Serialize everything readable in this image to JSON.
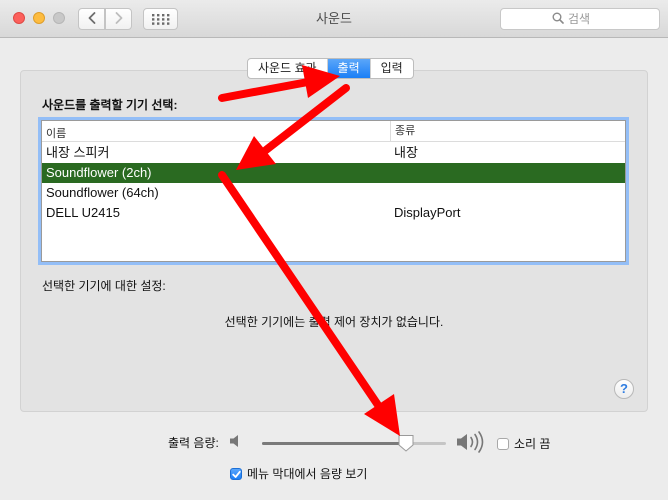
{
  "window": {
    "title": "사운드"
  },
  "toolbar": {
    "search_placeholder": "검색"
  },
  "tabs": [
    {
      "label": "사운드 효과",
      "active": false
    },
    {
      "label": "출력",
      "active": true
    },
    {
      "label": "입력",
      "active": false
    }
  ],
  "output": {
    "section_label": "사운드를 출력할 기기 선택:",
    "columns": {
      "name": "이름",
      "type": "종류"
    },
    "devices": [
      {
        "name": "내장 스피커",
        "type": "내장",
        "selected": false
      },
      {
        "name": "Soundflower (2ch)",
        "type": "",
        "selected": true
      },
      {
        "name": "Soundflower (64ch)",
        "type": "",
        "selected": false
      },
      {
        "name": "DELL U2415",
        "type": "DisplayPort",
        "selected": false
      }
    ],
    "settings_label": "선택한 기기에 대한 설정:",
    "no_controls_text": "선택한 기기에는 출력 제어 장치가 없습니다.",
    "help_label": "?"
  },
  "volume": {
    "label": "출력 음량:",
    "level": 0.78,
    "mute_label": "소리 끔",
    "mute_checked": false,
    "show_in_menu_bar_label": "메뉴 막대에서 음량 보기",
    "show_in_menu_bar_checked": true
  },
  "icons": {
    "back": "chevron-left-icon",
    "forward": "chevron-right-icon",
    "show_all": "grid-icon",
    "search": "magnifier-icon",
    "speaker_low": "speaker-low-icon",
    "speaker_high": "speaker-high-icon"
  },
  "colors": {
    "selection": "#2a6a21",
    "tab_active": "#1a7ff6",
    "annotation_arrow": "#ff0000"
  }
}
